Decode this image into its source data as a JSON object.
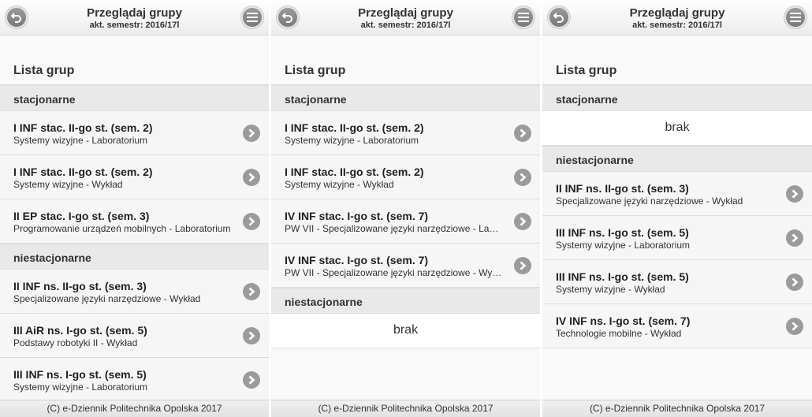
{
  "colors": {
    "accent_button": "#8a8a8a",
    "divider_bg": "#e9e9e9",
    "item_bg": "#f6f6f6"
  },
  "icons": {
    "back": "back-arrow-icon",
    "menu": "hamburger-menu-icon",
    "item": "chevron-right-icon"
  },
  "panels": [
    {
      "header": {
        "title": "Przeglądaj grupy",
        "subtitle": "akt. semestr: 2016/17l"
      },
      "list_title": "Lista grup",
      "sections": [
        {
          "label": "stacjonarne",
          "empty_text": "",
          "items": [
            {
              "title": "I INF stac. II-go st. (sem. 2)",
              "subtitle": "Systemy wizyjne - Laboratorium"
            },
            {
              "title": "I INF stac. II-go st. (sem. 2)",
              "subtitle": "Systemy wizyjne - Wykład"
            },
            {
              "title": "II EP stac. I-go st. (sem. 3)",
              "subtitle": "Programowanie urządzeń mobilnych - Laboratorium"
            }
          ]
        },
        {
          "label": "niestacjonarne",
          "empty_text": "",
          "items": [
            {
              "title": "II INF ns. II-go st. (sem. 3)",
              "subtitle": "Specjalizowane języki narzędziowe - Wykład"
            },
            {
              "title": "III AiR ns. I-go st. (sem. 5)",
              "subtitle": "Podstawy robotyki II - Wykład"
            },
            {
              "title": "III INF ns. I-go st. (sem. 5)",
              "subtitle": "Systemy wizyjne - Laboratorium"
            }
          ]
        }
      ],
      "footer": "(C) e-Dziennik Politechnika Opolska 2017"
    },
    {
      "header": {
        "title": "Przeglądaj grupy",
        "subtitle": "akt. semestr: 2016/17l"
      },
      "list_title": "Lista grup",
      "sections": [
        {
          "label": "stacjonarne",
          "empty_text": "",
          "items": [
            {
              "title": "I INF stac. II-go st. (sem. 2)",
              "subtitle": "Systemy wizyjne - Laboratorium"
            },
            {
              "title": "I INF stac. II-go st. (sem. 2)",
              "subtitle": "Systemy wizyjne - Wykład"
            },
            {
              "title": "IV INF stac. I-go st. (sem. 7)",
              "subtitle": "PW VII - Specjalizowane języki narzędziowe - Laboratorium"
            },
            {
              "title": "IV INF stac. I-go st. (sem. 7)",
              "subtitle": "PW VII - Specjalizowane języki narzędziowe - Wykład"
            }
          ]
        },
        {
          "label": "niestacjonarne",
          "empty_text": "brak",
          "items": []
        }
      ],
      "footer": "(C) e-Dziennik Politechnika Opolska 2017"
    },
    {
      "header": {
        "title": "Przeglądaj grupy",
        "subtitle": "akt. semestr: 2016/17l"
      },
      "list_title": "Lista grup",
      "sections": [
        {
          "label": "stacjonarne",
          "empty_text": "brak",
          "items": []
        },
        {
          "label": "niestacjonarne",
          "empty_text": "",
          "items": [
            {
              "title": "II INF ns. II-go st. (sem. 3)",
              "subtitle": "Specjalizowane języki narzędziowe - Wykład"
            },
            {
              "title": "III INF ns. I-go st. (sem. 5)",
              "subtitle": "Systemy wizyjne - Laboratorium"
            },
            {
              "title": "III INF ns. I-go st. (sem. 5)",
              "subtitle": "Systemy wizyjne - Wykład"
            },
            {
              "title": "IV INF ns. I-go st. (sem. 7)",
              "subtitle": "Technologie mobilne - Wykład"
            }
          ]
        }
      ],
      "footer": "(C) e-Dziennik Politechnika Opolska 2017"
    }
  ]
}
